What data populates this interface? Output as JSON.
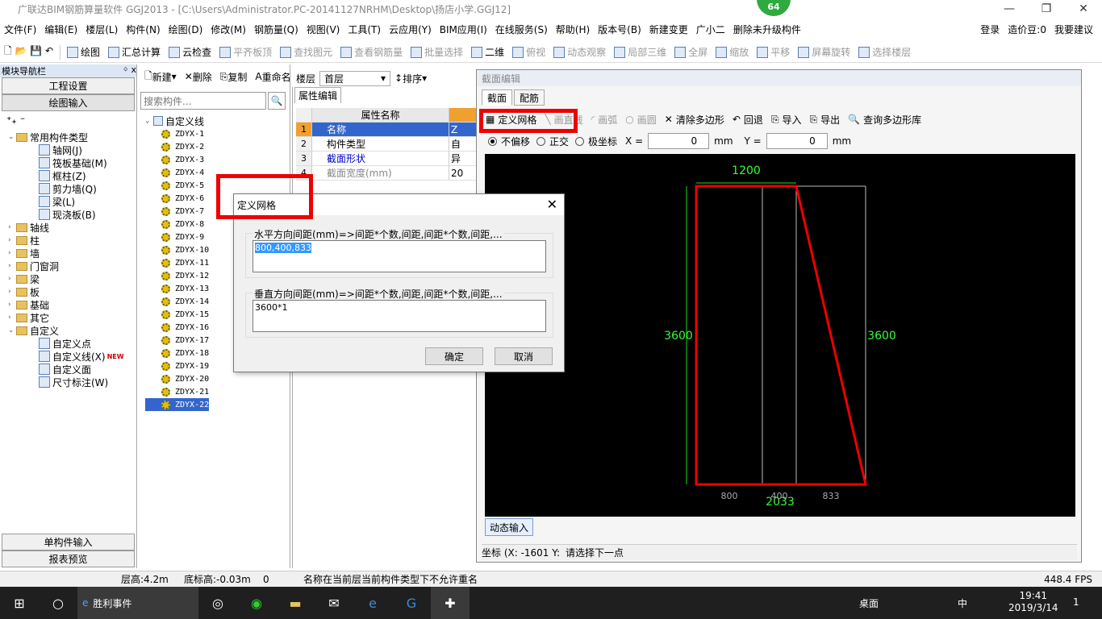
{
  "window": {
    "title": "广联达BIM钢筋算量软件 GGJ2013 - [C:\\Users\\Administrator.PC-20141127NRHM\\Desktop\\扬店小学.GGJ12]",
    "badge": "64"
  },
  "menu": [
    "文件(F)",
    "编辑(E)",
    "楼层(L)",
    "构件(N)",
    "绘图(D)",
    "修改(M)",
    "钢筋量(Q)",
    "视图(V)",
    "工具(T)",
    "云应用(Y)",
    "BIM应用(I)",
    "在线服务(S)",
    "帮助(H)",
    "版本号(B)",
    "新建变更",
    "广小二",
    "删除未升级构件"
  ],
  "menu_right": {
    "login": "登录",
    "cost": "造价豆:0",
    "suggest": "我要建议"
  },
  "ime": {
    "items": [
      "中",
      "°,",
      "🎤",
      "⌨"
    ]
  },
  "toolbar": [
    "绘图",
    "汇总计算",
    "云检查",
    "平齐板顶",
    "查找图元",
    "查看钢筋量",
    "批量选择",
    "二维",
    "俯视",
    "动态观察",
    "局部三维",
    "全屏",
    "缩放",
    "平移",
    "屏幕旋转",
    "选择楼层"
  ],
  "nav": {
    "title": "模块导航栏",
    "pin": "ᛜ x",
    "btn_project": "工程设置",
    "btn_draw": "绘图输入",
    "btn_single": "单构件输入",
    "btn_report": "报表预览",
    "tree": [
      {
        "label": "常用构件类型",
        "lvl": 0,
        "open": true
      },
      {
        "label": "轴网(J)",
        "lvl": 1
      },
      {
        "label": "筏板基础(M)",
        "lvl": 1
      },
      {
        "label": "框柱(Z)",
        "lvl": 1
      },
      {
        "label": "剪力墙(Q)",
        "lvl": 1
      },
      {
        "label": "梁(L)",
        "lvl": 1
      },
      {
        "label": "现浇板(B)",
        "lvl": 1
      },
      {
        "label": "轴线",
        "lvl": 0
      },
      {
        "label": "柱",
        "lvl": 0
      },
      {
        "label": "墙",
        "lvl": 0
      },
      {
        "label": "门窗洞",
        "lvl": 0
      },
      {
        "label": "梁",
        "lvl": 0
      },
      {
        "label": "板",
        "lvl": 0
      },
      {
        "label": "基础",
        "lvl": 0
      },
      {
        "label": "其它",
        "lvl": 0
      },
      {
        "label": "自定义",
        "lvl": 0,
        "open": true
      },
      {
        "label": "自定义点",
        "lvl": 1
      },
      {
        "label": "自定义线(X)",
        "lvl": 1,
        "new": "NEW"
      },
      {
        "label": "自定义面",
        "lvl": 1
      },
      {
        "label": "尺寸标注(W)",
        "lvl": 1
      }
    ]
  },
  "middle": {
    "new": "新建",
    "delete": "删除",
    "copy": "复制",
    "rename": "重命名",
    "floor_label": "楼层",
    "floor_value": "首层",
    "sort": "排序",
    "search_placeholder": "搜索构件...",
    "root": "自定义线",
    "items": [
      "ZDYX-1",
      "ZDYX-2",
      "ZDYX-3",
      "ZDYX-4",
      "ZDYX-5",
      "ZDYX-6",
      "ZDYX-7",
      "ZDYX-8",
      "ZDYX-9",
      "ZDYX-10",
      "ZDYX-11",
      "ZDYX-12",
      "ZDYX-13",
      "ZDYX-14",
      "ZDYX-15",
      "ZDYX-16",
      "ZDYX-17",
      "ZDYX-18",
      "ZDYX-19",
      "ZDYX-20",
      "ZDYX-21",
      "ZDYX-22"
    ],
    "selected": "ZDYX-22"
  },
  "props": {
    "tab": "属性编辑",
    "header": "属性名称",
    "rows": [
      {
        "n": "1",
        "name": "名称",
        "val": "Z"
      },
      {
        "n": "2",
        "name": "构件类型",
        "val": "自"
      },
      {
        "n": "3",
        "name": "截面形状",
        "val": "异"
      },
      {
        "n": "4",
        "name": "截面宽度(mm)",
        "val": "20"
      }
    ]
  },
  "editor": {
    "caption": "截面编辑",
    "tabs": [
      "截面",
      "配筋"
    ],
    "tools": [
      "定义网格",
      "画直线",
      "画弧",
      "画圆",
      "清除多边形",
      "回退",
      "导入",
      "导出",
      "查询多边形库"
    ],
    "offset_opts": [
      "不偏移",
      "正交",
      "极坐标"
    ],
    "x_label": "X =",
    "x_val": "0",
    "y_label": "Y =",
    "y_val": "0",
    "unit": "mm",
    "dyn": "动态输入",
    "coord": "坐标 (X: -1601 Y: 3",
    "prompt": "请选择下一点",
    "dims": {
      "top": "1200",
      "left": "3600",
      "right": "3600",
      "bottom": "2033",
      "b1": "800",
      "b2": "400",
      "b3": "833"
    }
  },
  "dialog": {
    "title": "定义网格",
    "h_label": "水平方向间距(mm)=>间距*个数,间距,间距*个数,间距,...",
    "h_value": "800,400,833",
    "v_label": "垂直方向间距(mm)=>间距*个数,间距,间距*个数,间距,...",
    "v_value": "3600*1",
    "ok": "确定",
    "cancel": "取消"
  },
  "status": {
    "floor_h": "层高:4.2m",
    "base_h": "底标高:-0.03m",
    "zero": "0",
    "msg": "名称在当前层当前构件类型下不允许重名",
    "fps": "448.4 FPS"
  },
  "taskbar": {
    "search": "胜利事件",
    "desktop": "桌面",
    "lang": "中",
    "time": "19:41",
    "date": "2019/3/14",
    "notif": "1"
  }
}
